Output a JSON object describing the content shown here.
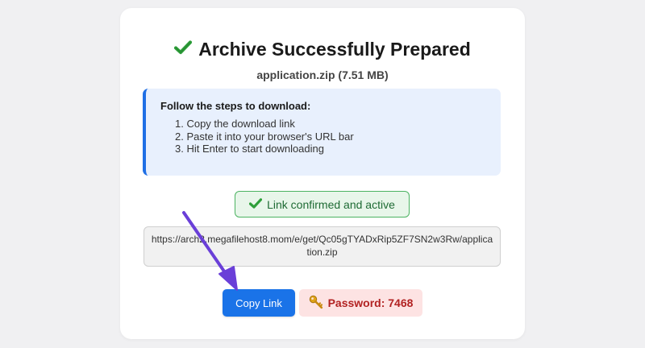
{
  "header": {
    "title": "Archive Successfully Prepared",
    "filename": "application.zip (7.51 MB)"
  },
  "instructions": {
    "heading": "Follow the steps to download:",
    "steps": [
      "1. Copy the download link",
      "2. Paste it into your browser's URL bar",
      "3. Hit Enter to start downloading"
    ]
  },
  "status": {
    "label": "Link confirmed and active"
  },
  "link": {
    "url": "https://arch2.megafilehost8.mom/e/get/Qc05gTYADxRip5ZF7SN2w3Rw/application.zip"
  },
  "actions": {
    "copy_label": "Copy Link",
    "password_label": "Password: 7468"
  },
  "icons": {
    "title": "check-icon",
    "status": "check-icon",
    "password": "key-icon",
    "overlay": "arrow-pointer-icon"
  },
  "colors": {
    "accent": "#1a73e8",
    "steps_border": "#1f6fe5",
    "steps_bg": "#e8f0fd",
    "success_text": "#1e6b34",
    "success_border": "#4cb362",
    "success_bg": "#e8f6ea",
    "password_text": "#b22222",
    "password_bg": "#fde3e3",
    "arrow": "#6a3fd8"
  }
}
